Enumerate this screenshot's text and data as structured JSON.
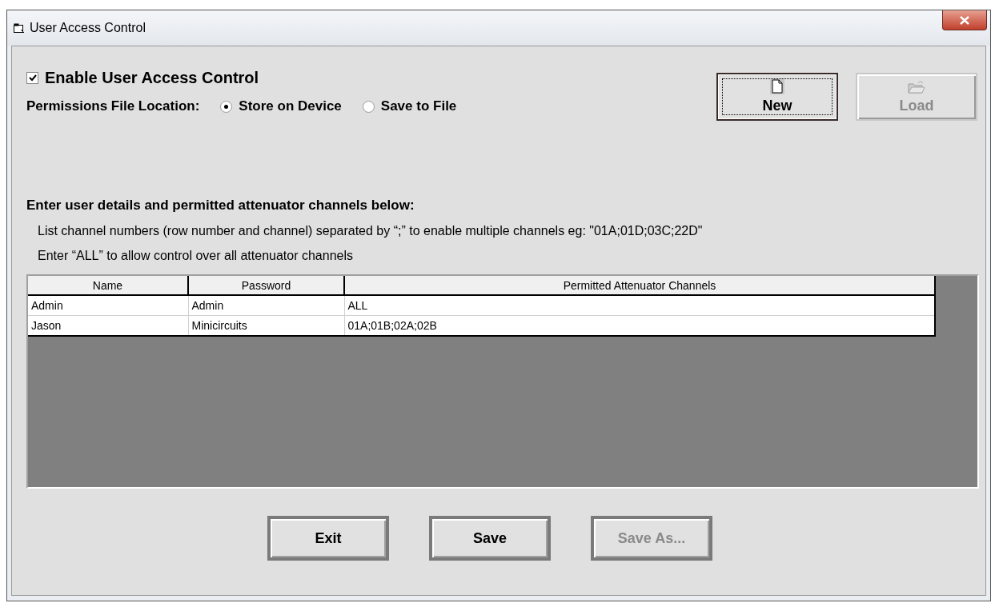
{
  "window": {
    "title": "User Access Control"
  },
  "enable": {
    "label": "Enable User Access Control",
    "checked": true
  },
  "location": {
    "label": "Permissions File Location:",
    "options": [
      {
        "label": "Store on Device",
        "selected": true
      },
      {
        "label": "Save to File",
        "selected": false
      }
    ]
  },
  "top_buttons": [
    {
      "kind": "new",
      "label": "New",
      "disabled": false,
      "focused": true
    },
    {
      "kind": "load",
      "label": "Load",
      "disabled": true,
      "focused": false
    }
  ],
  "instructions": {
    "heading": "Enter user details and permitted attenuator channels below:",
    "lines": [
      "List channel numbers (row number and channel) separated by “;” to enable multiple channels eg: \"01A;01D;03C;22D\"",
      "Enter “ALL” to allow control over all attenuator channels"
    ]
  },
  "table": {
    "columns": [
      "Name",
      "Password",
      "Permitted Attenuator Channels"
    ],
    "rows": [
      [
        "Admin",
        "Admin",
        "ALL"
      ],
      [
        "Jason",
        "Minicircuits",
        "01A;01B;02A;02B"
      ]
    ]
  },
  "buttons": [
    {
      "label": "Exit",
      "disabled": false
    },
    {
      "label": "Save",
      "disabled": false
    },
    {
      "label": "Save As...",
      "disabled": true
    }
  ]
}
